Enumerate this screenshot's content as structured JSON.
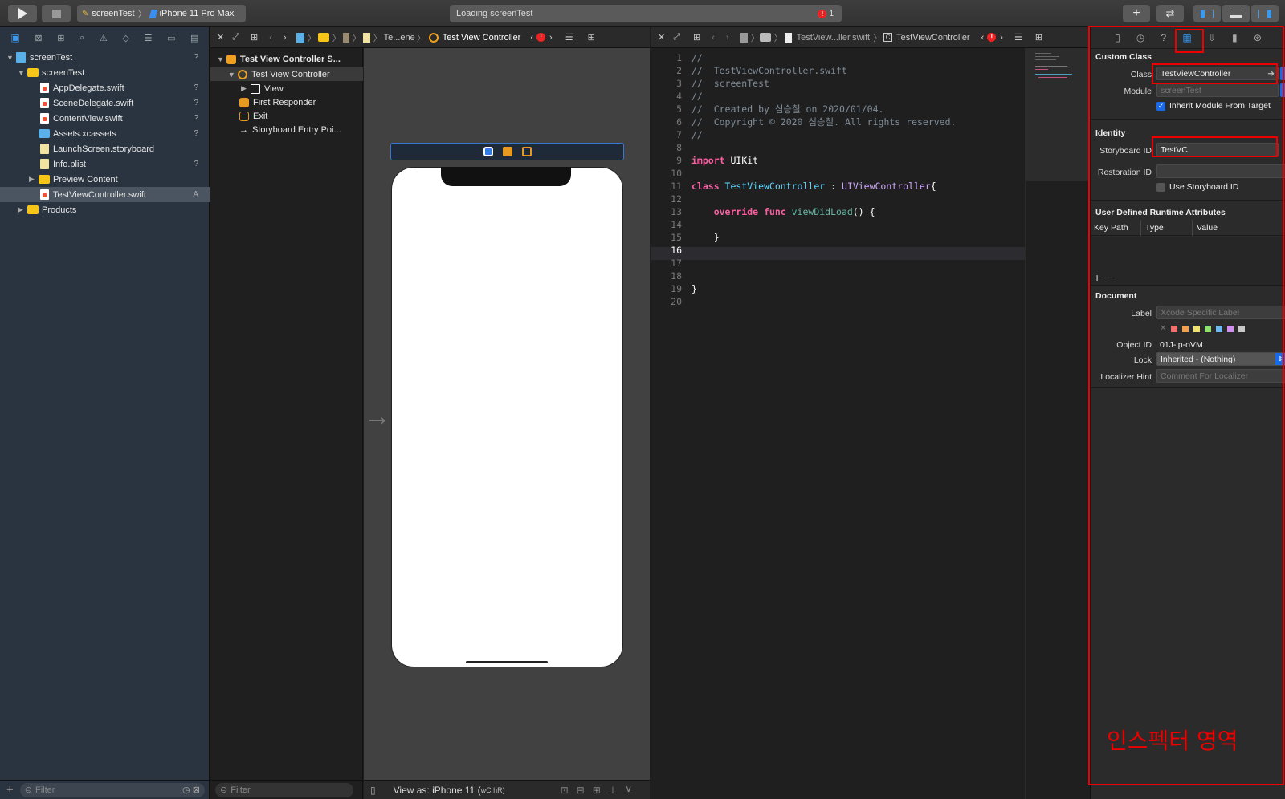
{
  "toolbar": {
    "scheme_target": "screenTest",
    "device": "iPhone 11 Pro Max",
    "status": "Loading screenTest",
    "error_count": "1"
  },
  "navigator": {
    "items": [
      {
        "label": "screenTest",
        "badge": "?"
      },
      {
        "label": "screenTest",
        "badge": ""
      },
      {
        "label": "AppDelegate.swift",
        "badge": "?"
      },
      {
        "label": "SceneDelegate.swift",
        "badge": "?"
      },
      {
        "label": "ContentView.swift",
        "badge": "?"
      },
      {
        "label": "Assets.xcassets",
        "badge": "?"
      },
      {
        "label": "LaunchScreen.storyboard",
        "badge": ""
      },
      {
        "label": "Info.plist",
        "badge": "?"
      },
      {
        "label": "Preview Content",
        "badge": ""
      },
      {
        "label": "TestViewController.swift",
        "badge": "A"
      },
      {
        "label": "Products",
        "badge": ""
      }
    ],
    "filter_placeholder": "Filter"
  },
  "outline": {
    "items": [
      {
        "label": "Test View Controller S..."
      },
      {
        "label": "Test View Controller"
      },
      {
        "label": "View"
      },
      {
        "label": "First Responder"
      },
      {
        "label": "Exit"
      },
      {
        "label": "Storyboard Entry Poi..."
      }
    ],
    "filter_placeholder": "Filter"
  },
  "editor1": {
    "breadcrumb_scene": "Te...ene",
    "breadcrumb_vc": "Test View Controller",
    "view_as": "View as: iPhone 11 (",
    "view_as_size": "wC hR)"
  },
  "editor2": {
    "breadcrumb_file": "TestView...ller.swift",
    "breadcrumb_class": "TestViewController",
    "current_line": "16",
    "lines": [
      {
        "n": "1",
        "t": "//"
      },
      {
        "n": "2",
        "t": "//  TestViewController.swift"
      },
      {
        "n": "3",
        "t": "//  screenTest"
      },
      {
        "n": "4",
        "t": "//"
      },
      {
        "n": "5",
        "t": "//  Created by 심승철 on 2020/01/04."
      },
      {
        "n": "6",
        "t": "//  Copyright © 2020 심승철. All rights reserved."
      },
      {
        "n": "7",
        "t": "//"
      },
      {
        "n": "8",
        "t": ""
      },
      {
        "n": "9",
        "kw": "import",
        "rest": " UIKit"
      },
      {
        "n": "10",
        "t": ""
      },
      {
        "n": "11",
        "kw": "class",
        "cls": " TestViewController",
        "mid": " : ",
        "sup": "UIViewController",
        "end": "{"
      },
      {
        "n": "12",
        "t": ""
      },
      {
        "n": "13",
        "kw": "    override func",
        "fn": " viewDidLoad",
        "end": "() {"
      },
      {
        "n": "14",
        "t": ""
      },
      {
        "n": "15",
        "t": "    }"
      },
      {
        "n": "16",
        "t": ""
      },
      {
        "n": "17",
        "t": ""
      },
      {
        "n": "18",
        "t": ""
      },
      {
        "n": "19",
        "t": "}"
      },
      {
        "n": "20",
        "t": ""
      }
    ]
  },
  "inspector": {
    "custom_class_header": "Custom Class",
    "class_label": "Class",
    "class_value": "TestViewController",
    "module_label": "Module",
    "module_placeholder": "screenTest",
    "inherit_module": "Inherit Module From Target",
    "identity_header": "Identity",
    "storyboard_id_label": "Storyboard ID",
    "storyboard_id_value": "TestVC",
    "restoration_id_label": "Restoration ID",
    "use_storyboard_id": "Use Storyboard ID",
    "udra_header": "User Defined Runtime Attributes",
    "col_keypath": "Key Path",
    "col_type": "Type",
    "col_value": "Value",
    "document_header": "Document",
    "label_label": "Label",
    "label_placeholder": "Xcode Specific Label",
    "object_id_label": "Object ID",
    "object_id_value": "01J-lp-oVM",
    "lock_label": "Lock",
    "lock_value": "Inherited - (Nothing)",
    "localizer_label": "Localizer Hint",
    "localizer_placeholder": "Comment For Localizer",
    "label_colors": [
      "#f07070",
      "#f0a050",
      "#f0e070",
      "#90e070",
      "#70b8f0",
      "#d090f0",
      "#c8c8c8"
    ]
  },
  "annotation": "인스펙터 영역"
}
